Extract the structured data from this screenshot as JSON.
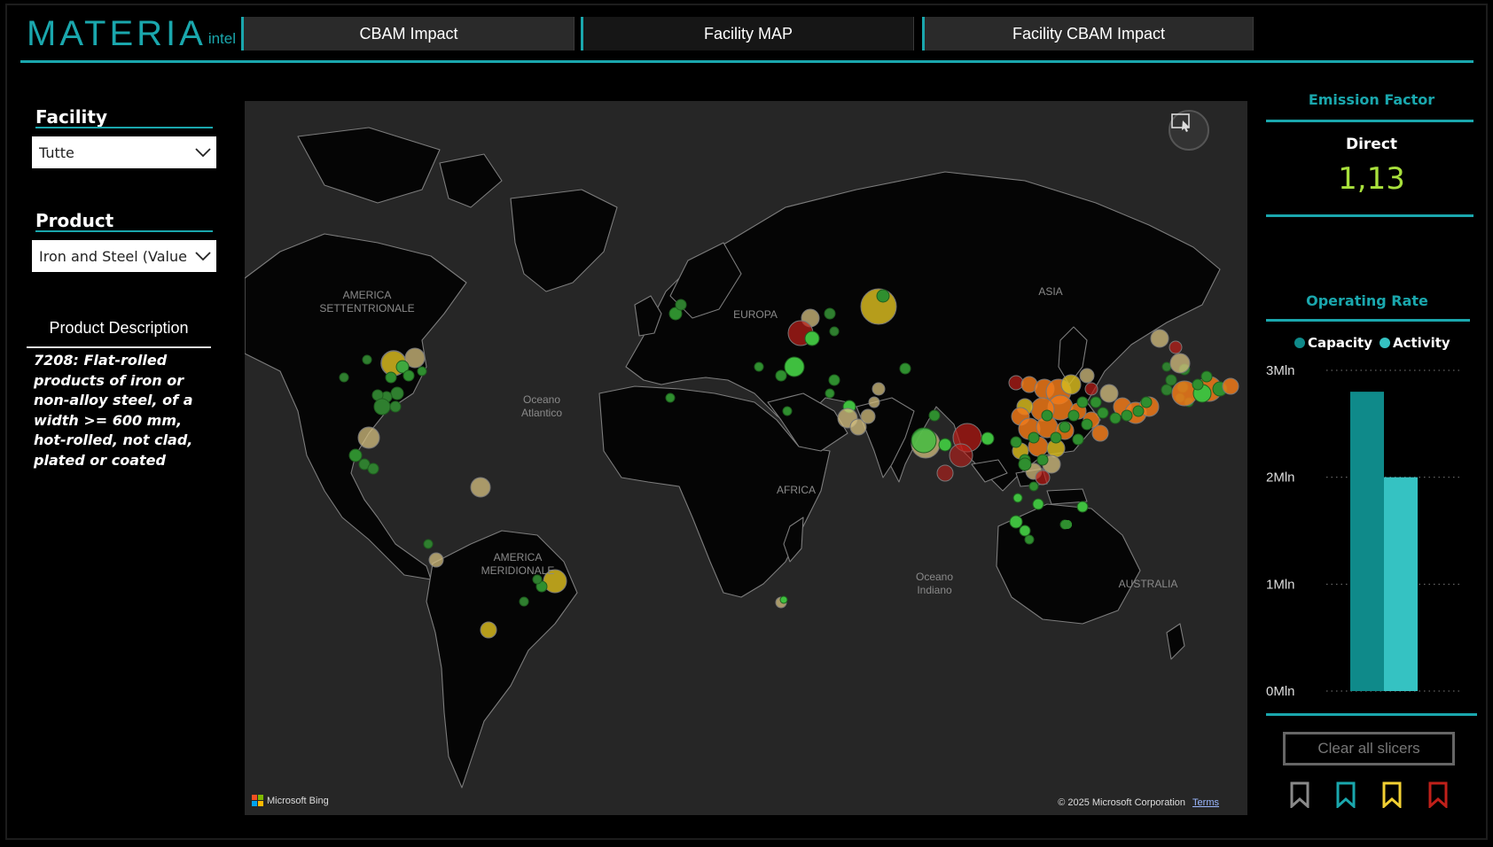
{
  "header": {
    "logo_main": "MATERIA",
    "logo_sub": "intel",
    "tabs": [
      {
        "label": "CBAM Impact",
        "active": false
      },
      {
        "label": "Facility MAP",
        "active": true
      },
      {
        "label": "Facility CBAM Impact",
        "active": false
      }
    ]
  },
  "filters": {
    "facility": {
      "title": "Facility",
      "value": "Tutte"
    },
    "product": {
      "title": "Product",
      "value": "Iron and Steel (Value ..."
    }
  },
  "product_description": {
    "title": "Product Description",
    "text": "7208: Flat-rolled products of iron or non-alloy steel, of a width >= 600 mm, hot-rolled, not clad, plated or coated"
  },
  "map": {
    "labels": {
      "north_america": "AMERICA SETTENTRIONALE",
      "europe": "EUROPA",
      "asia": "ASIA",
      "atlantic": "Oceano Atlantico",
      "africa": "AFRICA",
      "south_america": "AMERICA MERIDIONALE",
      "indian": "Oceano Indiano",
      "australia": "AUSTRALIA"
    },
    "attribution": "Microsoft Bing",
    "copyright": "© 2025 Microsoft Corporation",
    "terms": "Terms",
    "facility_colors": {
      "low": "#3fbf3f",
      "mid": "#d6c04a",
      "high": "#f07a1a",
      "very_high": "#c0201a"
    }
  },
  "emission_factor": {
    "title": "Emission Factor",
    "label": "Direct",
    "value": "1,13",
    "value_color": "#a8e03c"
  },
  "operating_rate": {
    "title": "Operating Rate",
    "chart_data": {
      "type": "bar",
      "series": [
        {
          "name": "Capacity",
          "values": [
            2.8
          ],
          "color": "#0f8a8a"
        },
        {
          "name": "Activity",
          "values": [
            2.0
          ],
          "color": "#35c2c2"
        }
      ],
      "yticks": [
        "0Mln",
        "1Mln",
        "2Mln",
        "3Mln"
      ],
      "ylim": [
        0,
        3
      ],
      "grid": true,
      "legend": "top"
    }
  },
  "actions": {
    "clear_label": "Clear all slicers",
    "bookmark_colors": [
      "#8a8a8a",
      "#1aa7ad",
      "#f2d033",
      "#c0201a"
    ]
  }
}
